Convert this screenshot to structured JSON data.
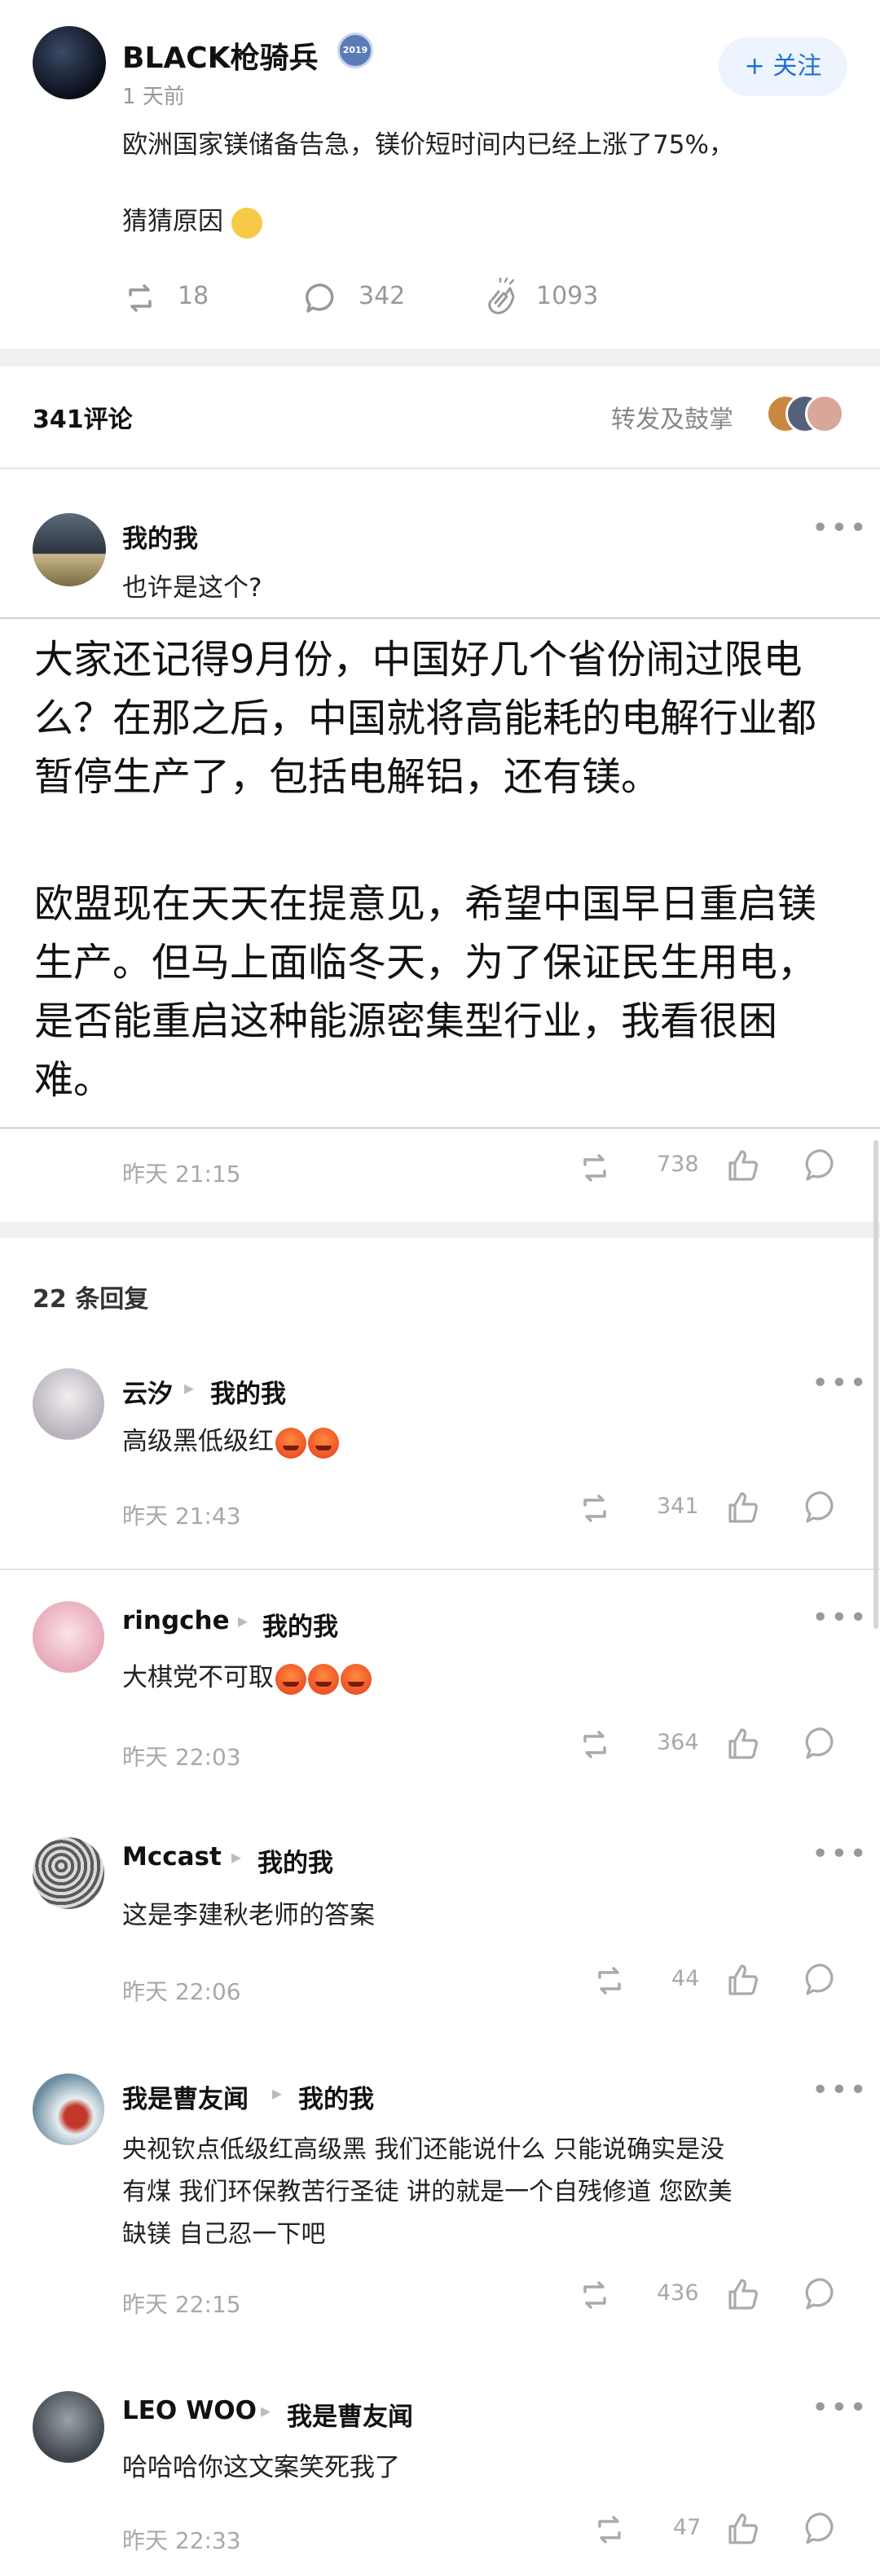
{
  "post": {
    "author": "BLACK枪骑兵",
    "badge": "2019",
    "time": "1 天前",
    "follow_label": "+ 关注",
    "text_line1": "欧洲国家镁储备告急，镁价短时间内已经上涨了75%，",
    "text_line2": "猜猜原因",
    "repost_count": "18",
    "comment_count": "342",
    "like_count": "1093"
  },
  "comments_header": {
    "count_label": "341评论",
    "right_label": "转发及鼓掌"
  },
  "main_comment": {
    "author": "我的我",
    "short_text": "也许是这个?",
    "body_p1": "大家还记得9月份，中国好几个省份闹过限电么？在那之后，中国就将高能耗的电解行业都暂停生产了，包括电解铝，还有镁。",
    "body_p2": "欧盟现在天天在提意见，希望中国早日重启镁生产。但马上面临冬天，为了保证民生用电，是否能重启这种能源密集型行业，我看很困难。",
    "time": "昨天 21:15",
    "repost": "738"
  },
  "replies_header": {
    "label": "22 条回复"
  },
  "replies": [
    {
      "author": "云汐",
      "reply_to": "我的我",
      "text": "高级黑低级红",
      "emoji_count": 2,
      "time": "昨天 21:43",
      "count": "341"
    },
    {
      "author": "ringche",
      "reply_to": "我的我",
      "text": "大棋党不可取",
      "emoji_count": 3,
      "time": "昨天 22:03",
      "count": "364"
    },
    {
      "author": "Mccast",
      "reply_to": "我的我",
      "text": "这是李建秋老师的答案",
      "emoji_count": 0,
      "time": "昨天 22:06",
      "count": "44"
    },
    {
      "author": "我是曹友闻",
      "reply_to": "我的我",
      "text_l1": "央视钦点低级红高级黑 我们还能说什么 只能说确实是没",
      "text_l2": "有煤 我们环保教苦行圣徒 讲的就是一个自残修道 您欧美",
      "text_l3": "缺镁 自己忍一下吧",
      "time": "昨天 22:15",
      "count": "436"
    },
    {
      "author": "LEO WOO",
      "reply_to": "我是曹友闻",
      "text": "哈哈哈你这文案笑死我了",
      "emoji_count": 0,
      "time": "昨天 22:33",
      "count": "47"
    }
  ],
  "colors": {
    "accent": "#1e6fd9",
    "follow_bg": "#eef4fd",
    "separator": "#f0f0f0"
  }
}
